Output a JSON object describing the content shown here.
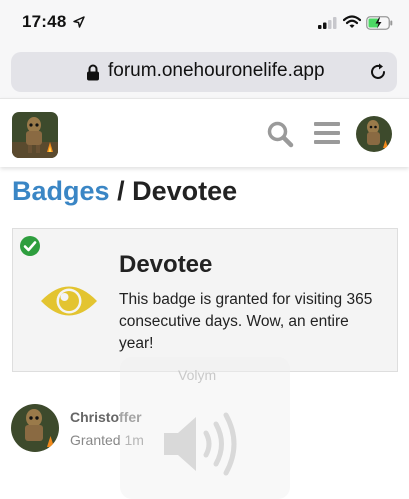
{
  "status_bar": {
    "time": "17:48",
    "icons": [
      "location-arrow-icon",
      "signal-icon",
      "wifi-icon",
      "battery-charging-icon"
    ]
  },
  "browser": {
    "url": "forum.onehouronelife.app",
    "icons": [
      "lock-icon",
      "reload-icon"
    ]
  },
  "header": {
    "icons": [
      "site-logo",
      "search-icon",
      "menu-icon",
      "avatar"
    ]
  },
  "breadcrumb": {
    "link": "Badges",
    "separator": "/",
    "current": "Devotee"
  },
  "badge": {
    "name": "Devotee",
    "description": "This badge is granted for visiting 365 consecutive days. Wow, an entire year!",
    "icon": "eye-icon",
    "granted_icon": "check-circle-icon"
  },
  "overlay": {
    "label": "Volym",
    "icon": "speaker-icon"
  },
  "grantees": [
    {
      "username": "Christoffer",
      "granted": "Granted 1m"
    }
  ],
  "colors": {
    "link_blue": "#3a86c5",
    "check_green": "#2e9e3e",
    "eye_yellow": "#e3c430",
    "battery_green": "#4cd964"
  }
}
